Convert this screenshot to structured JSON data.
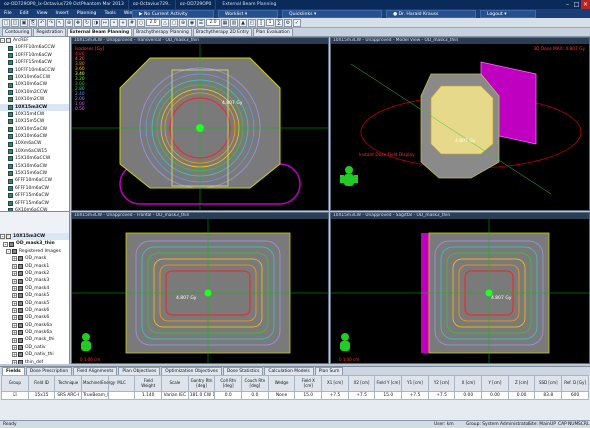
{
  "titlebar": {
    "tabs": [
      "oz-OD729OP0_ix-Octavius729 OctPhantom Mar 2013",
      "oz-Octavius729..",
      "oz-OD729OP0"
    ],
    "title": "External Beam Planning"
  },
  "menubar": {
    "items": [
      "File",
      "Edit",
      "View",
      "Insert",
      "Planning",
      "Tools",
      "Window"
    ],
    "center_buttons": [
      "No Current Activity",
      "Worklist",
      "Quicklinks",
      "Dr. Harald Krauss",
      "Logout"
    ]
  },
  "toolbar": {
    "zoom1": "2.0",
    "zoom2": "2.0",
    "zoom3": "1"
  },
  "workspace_tabs": [
    "Contouring",
    "Registration",
    "External Beam Planning",
    "Brachytherapy Planning",
    "Brachytherapy 2D Entry",
    "Plan Evaluation"
  ],
  "tree": {
    "top_label": "ArcREF",
    "fields": [
      "10FFF10m6aCCW",
      "10FFF10m6aCW",
      "10FFF15m6aCW",
      "10FFF10m6aCCW",
      "10X10m6aCCW",
      "10X10m6aCW",
      "10X10m2CCW",
      "10X10m2CW",
      "10X15m3CW",
      "10X15m4CW",
      "10X15m5CW",
      "10X10m5aCW",
      "10X10m6aCW",
      "10Xm6aCW",
      "10Xm6aCW15",
      "15X10m6aCCW",
      "15X10m6aCW",
      "15X15m6aCW",
      "6FFF10m6aCCW",
      "6FFF10m6aCW",
      "6FFF15m6aCW",
      "6FFF15m6aCW",
      "6X10m6aCCW",
      "6X10m6aCW",
      "6X15m6aCW"
    ],
    "selected_index": 8
  },
  "tree2": {
    "plan_label": "10X15m3CW",
    "course_label": "OD_mask3_thin",
    "registered_label": "Registered Images",
    "images": [
      "OD_mask",
      "OD_mask1",
      "OD_mask2",
      "OD_mask3",
      "OD_mask4",
      "OD_mask5",
      "OD_mask5",
      "OD_mask6",
      "OD_mask6",
      "OD_mask6a",
      "OD_mask6a",
      "OD_mask_thi",
      "OD_nativ",
      "OD_nativ_thi",
      "thin_def"
    ]
  },
  "views": {
    "transversal": {
      "title": "10X15m3CW - Unapproved - Transversal - OD_mask3_thin",
      "label": "Isodoses [Gy]"
    },
    "model": {
      "title": "10X15m3CW - Unapproved - Model View - OD_mask3_thin",
      "label": "3D Dose MAX: 4.807 Gy"
    },
    "frontal": {
      "title": "10X15m3CW - Unapproved - Frontal - OD_mask3_thin"
    },
    "sagittal": {
      "title": "10X15m3CW - Unapproved - Sagittal - OD_mask3_thin"
    }
  },
  "isodose_levels": [
    {
      "value": "4.80",
      "color": "#ff2020"
    },
    {
      "value": "4.20",
      "color": "#ff6666"
    },
    {
      "value": "3.80",
      "color": "#ff9900"
    },
    {
      "value": "3.60",
      "color": "#ffd000"
    },
    {
      "value": "3.40",
      "color": "#ffff66"
    },
    {
      "value": "3.20",
      "color": "#66ff66"
    },
    {
      "value": "3.00",
      "color": "#33cc33"
    },
    {
      "value": "2.80",
      "color": "#33cccc"
    },
    {
      "value": "2.40",
      "color": "#6699ff"
    },
    {
      "value": "2.00",
      "color": "#9999ff"
    },
    {
      "value": "1.00",
      "color": "#cc66ff"
    },
    {
      "value": "0.50",
      "color": "#ff66ff"
    }
  ],
  "view_annotations": {
    "trans_dose": "4.807 Gy",
    "model_dose": "4.807 Gy",
    "model_note": "Instant Dose Field Display",
    "frontal_dose": "4.807 Gy",
    "sagittal_dose": "4.807 Gy",
    "frontal_scale": "0   1.00 cm",
    "sagittal_scale": "0   1.00 cm"
  },
  "bottom_tabs": [
    "Fields",
    "Dose Prescription",
    "Field Alignments",
    "Plan Objectives",
    "Optimization Objectives",
    "Dose Statistics",
    "Calculation Models",
    "Plan Sum"
  ],
  "field_table": {
    "headers": [
      "Group",
      "Field ID",
      "Technique",
      "Machine/Energy",
      "MLC",
      "Field Weight",
      "Scale",
      "Gantry Rtn [deg]",
      "Coll Rtn [deg]",
      "Couch Rtn [deg]",
      "Wedge",
      "Field X [cm]",
      "X1 [cm]",
      "X2 [cm]",
      "Field Y [cm]",
      "Y1 [cm]",
      "Y2 [cm]",
      "X [cm]",
      "Y [cm]",
      "Z [cm]",
      "SSD [cm]",
      "Ref. D [Gy]"
    ],
    "rows": [
      [
        "",
        "15x15",
        "SRS ARC-I",
        "TrueBeam_BLAU - 10X",
        "",
        "1.140",
        "Varian IEC",
        "181.0 CW 179.0",
        "0.0",
        "0.0",
        "None",
        "15.0",
        "+7.5",
        "+7.5",
        "15.0",
        "+7.5",
        "+7.5",
        "0.00",
        "0.00",
        "0.00",
        "83.8",
        "600"
      ]
    ]
  },
  "status": {
    "left": "Ready",
    "user": "User: km",
    "group": "Group: System Administrator",
    "site": "Site: Main",
    "indicators": [
      "UP",
      "CAP",
      "NUM",
      "SCRL"
    ]
  },
  "colors": {
    "accent": "#1a3f76",
    "title": "#0a2a5a"
  }
}
